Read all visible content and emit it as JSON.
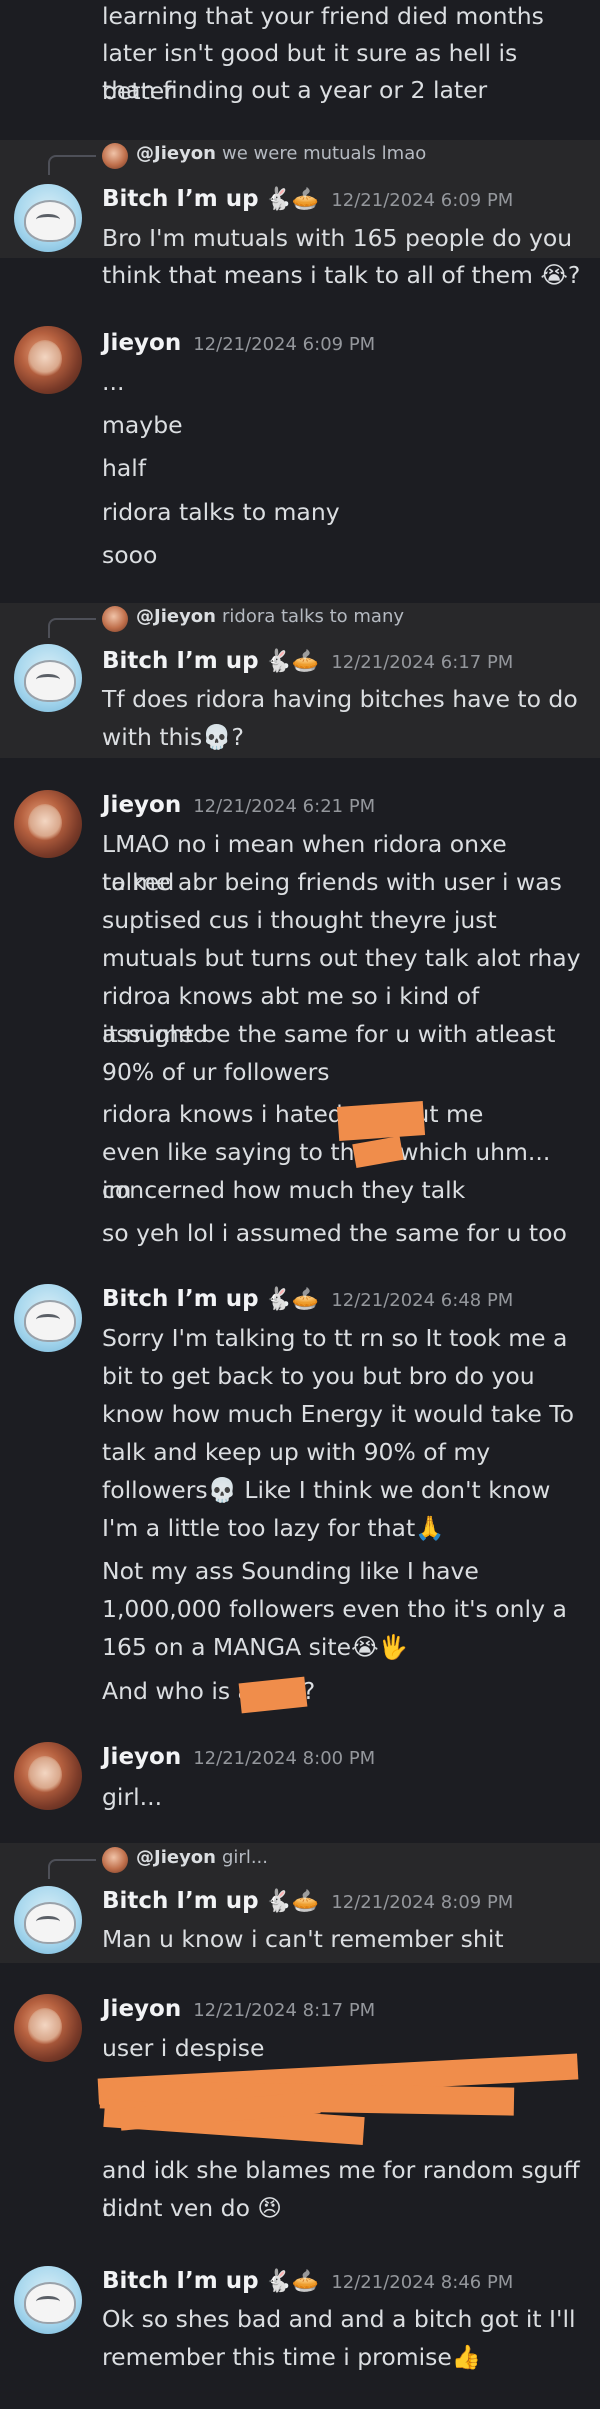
{
  "top_continuation": [
    "learning that your friend died months",
    "later isn't good but it sure as hell is better",
    "than finding out a year or 2 later"
  ],
  "badges": "🐇🥧",
  "messages": [
    {
      "reply_to": {
        "author": "@Jieyon",
        "text": "we were mutuals lmao"
      },
      "author": "Bitch I’m up",
      "timestamp": "12/21/2024 6:09 PM",
      "lines": [
        "Bro I'm mutuals with 165 people do you",
        "think that means i talk to all of them 😭?"
      ]
    },
    {
      "author": "Jieyon",
      "timestamp": "12/21/2024 6:09 PM",
      "lines": [
        "...",
        "maybe",
        "half",
        "ridora talks to many",
        "sooo"
      ]
    },
    {
      "reply_to": {
        "author": "@Jieyon",
        "text": "ridora talks to many"
      },
      "author": "Bitch I’m up",
      "timestamp": "12/21/2024 6:17 PM",
      "lines": [
        "Tf does ridora having bitches have to do",
        "with this💀?"
      ]
    },
    {
      "author": "Jieyon",
      "timestamp": "12/21/2024 6:21 PM",
      "lines": [
        "LMAO no i mean when ridora onxe talked",
        "to me abr being friends with user i was",
        "suptised cus i thought theyre just",
        "mutuals but turns out they talk alot rhay",
        "ridroa knows abt me so i kind of assumed",
        "it might be the same for u with atleast",
        "90% of ur followers",
        "ridora knows i hated             without me",
        "even like saying to them which uhm... im",
        "concerned how much they talk",
        "so yeh lol i assumed the same for u too"
      ]
    },
    {
      "author": "Bitch I’m up",
      "timestamp": "12/21/2024 6:48 PM",
      "lines": [
        "Sorry I'm talking to tt rn so It took me a",
        "bit to get back to you but bro do you",
        "know how much Energy it would take To",
        "talk and keep up with 90% of my",
        "followers💀 Like I think we don't know",
        "I'm a little too lazy for that🙏",
        "Not my ass Sounding like I have",
        "1,000,000 followers even tho it's only a",
        "165 on a MANGA site😭🖐",
        "And who is              again?"
      ]
    },
    {
      "author": "Jieyon",
      "timestamp": "12/21/2024 8:00 PM",
      "lines": [
        "girl..."
      ]
    },
    {
      "reply_to": {
        "author": "@Jieyon",
        "text": "girl..."
      },
      "author": "Bitch I’m up",
      "timestamp": "12/21/2024 8:09 PM",
      "lines": [
        "Man u know i can't remember shit"
      ]
    },
    {
      "author": "Jieyon",
      "timestamp": "12/21/2024 8:17 PM",
      "lines": [
        "user i despise",
        "",
        "",
        "and idk she blames me for random sguff i",
        "didnt ven do 😠"
      ]
    },
    {
      "author": "Bitch I’m up",
      "timestamp": "12/21/2024 8:46 PM",
      "lines": [
        "Ok so shes bad and and a bitch got it I'll",
        "remember this time i promise👍"
      ]
    }
  ],
  "colors": {
    "background": "#1c1d22",
    "reply_highlight": "#28282a",
    "redaction": "#f08d4b",
    "timestamp": "#94979c"
  }
}
